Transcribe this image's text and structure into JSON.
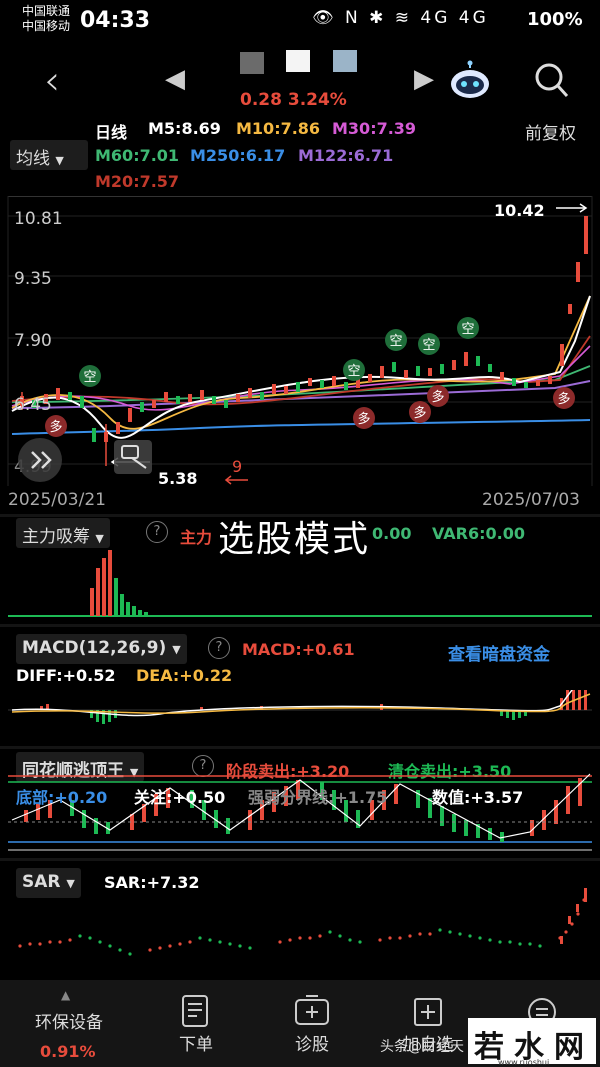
{
  "status_bar": {
    "carrier1": "中国联通",
    "carrier2": "中国移动",
    "time": "04:33",
    "icons": "👁 N ✱ ≋ 4G 4G",
    "battery": "100%"
  },
  "header": {
    "price_change": "0.28 3.24%"
  },
  "ma_bar": {
    "select_label": "均线",
    "period": "日线",
    "m5": "M5:8.69",
    "m10": "M10:7.86",
    "m30": "M30:7.39",
    "m60": "M60:7.01",
    "m250": "M250:6.17",
    "m122": "M122:6.71",
    "m20": "M20:7.57",
    "adjust": "前复权",
    "colors": {
      "m5": "#ffffff",
      "m10": "#f5b942",
      "m30": "#d65bd6",
      "m60": "#3fb873",
      "m250": "#3a8ee6",
      "m122": "#9b6bd6",
      "m20": "#c0392b"
    }
  },
  "kline": {
    "y_ticks": [
      "10.81",
      "9.35",
      "7.90",
      "6.45",
      "4.99"
    ],
    "date_start": "2025/03/21",
    "date_end": "2025/07/03",
    "high_label": "10.42",
    "low_label": "5.38",
    "marker_9": "9",
    "kong": "空",
    "duo": "多",
    "mode_text": "选股模式"
  },
  "panel_zhuli": {
    "select_label": "主力吸筹",
    "val1_prefix": "主力",
    "val1_suffix": "0.00",
    "var6": "VAR6:0.00"
  },
  "panel_macd": {
    "select_label": "MACD(12,26,9)",
    "macd": "MACD:+0.61",
    "link": "查看暗盘资金",
    "diff": "DIFF:+0.52",
    "dea": "DEA:+0.22"
  },
  "panel_ths": {
    "select_label": "同花顺逃顶王",
    "stage_sell": "阶段卖出:+3.20",
    "clear_sell": "清仓卖出:+3.50",
    "bottom": "底部:+0.20",
    "focus": "关注:+0.50",
    "strong_weak": "强弱分界线:+1.75",
    "value": "数值:+3.57"
  },
  "panel_sar": {
    "select_label": "SAR",
    "sar": "SAR:+7.32"
  },
  "bottom_bar": {
    "sector": "环保设备",
    "sector_change": "0.91%",
    "order": "下单",
    "diagnose": "诊股",
    "add_fav": "加自选",
    "more": "更多",
    "attribution": "头条@财经天"
  },
  "watermark": {
    "text": "若水网",
    "sub": "www.ruoshui"
  }
}
